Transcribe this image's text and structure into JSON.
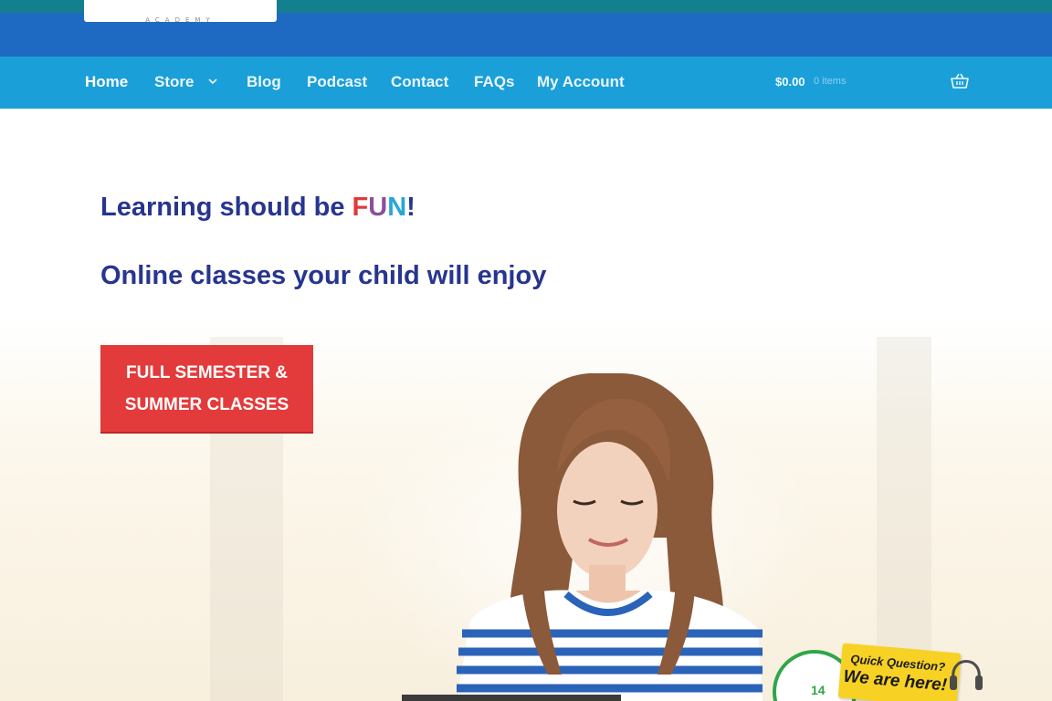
{
  "header": {
    "logo_subtext": "ACADEMY"
  },
  "nav": {
    "items": [
      {
        "label": "Home"
      },
      {
        "label": "Store"
      },
      {
        "label": "Blog"
      },
      {
        "label": "Podcast"
      },
      {
        "label": "Contact"
      },
      {
        "label": "FAQs"
      },
      {
        "label": "My Account"
      }
    ],
    "active": "Home",
    "store_dropdown_icon": "chevron-down-icon",
    "cart": {
      "total": "$0.00",
      "count": "0 items",
      "icon": "basket-icon"
    }
  },
  "hero": {
    "headline_prefix": "Learning should be ",
    "headline_fun_f": "F",
    "headline_fun_u": "U",
    "headline_fun_n": "N",
    "headline_fun_exclaim": "!",
    "subheadline": "Online classes your child will enjoy",
    "cta_line1": "FULL SEMESTER &",
    "cta_line2": "SUMMER CLASSES",
    "image": "girl-with-laptop-photo"
  },
  "chat_widget": {
    "question": "Quick Question?",
    "answer": "We are here!",
    "number": "14",
    "icon": "headset-icon"
  },
  "colors": {
    "top_strip": "#137f8f",
    "header_band": "#1e6ac3",
    "nav_bar": "#1a9fd9",
    "headline": "#27358f",
    "cta": "#e33b3b",
    "fun_f": "#e03a3a",
    "fun_u": "#8d4f9a",
    "fun_n": "#27a7d8",
    "chat_note": "#f7d225"
  }
}
